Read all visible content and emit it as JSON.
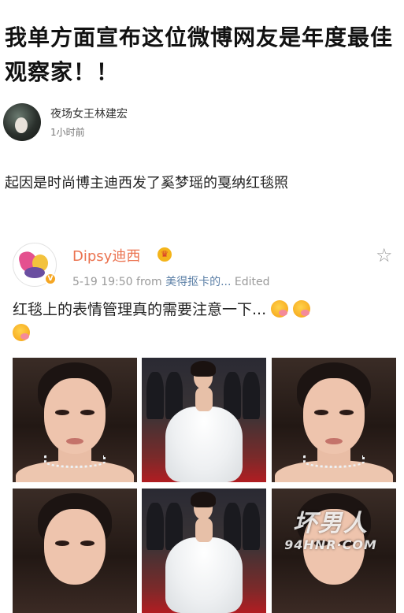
{
  "article": {
    "title": "我单方面宣布这位微博网友是年度最佳观察家！！",
    "author_name": "夜场女王林建宏",
    "author_time": "1小时前",
    "intro": "起因是时尚博主迪西发了奚梦瑶的戛纳红毯照"
  },
  "post": {
    "name": "Dipsy迪西",
    "date": "5-19 19:50",
    "from_label": "from",
    "source": "美得抠卡的...",
    "edited": "Edited",
    "text": "红毯上的表情管理真的需要注意一下...",
    "verified_badge": "V",
    "photos": [
      {
        "kind": "portrait"
      },
      {
        "kind": "event"
      },
      {
        "kind": "portrait"
      },
      {
        "kind": "portrait"
      },
      {
        "kind": "event"
      },
      {
        "kind": "portrait"
      }
    ]
  },
  "watermark": {
    "line1": "坏男人",
    "line2": "94HNR·COM"
  },
  "icons": {
    "favorite": "star-outline-icon",
    "crown": "crown-emoji-icon",
    "emoji": "yummy-face-emoji-icon"
  },
  "colors": {
    "post_name": "#eb7350",
    "source_link": "#5b7fa6",
    "verified": "#f5a623"
  }
}
